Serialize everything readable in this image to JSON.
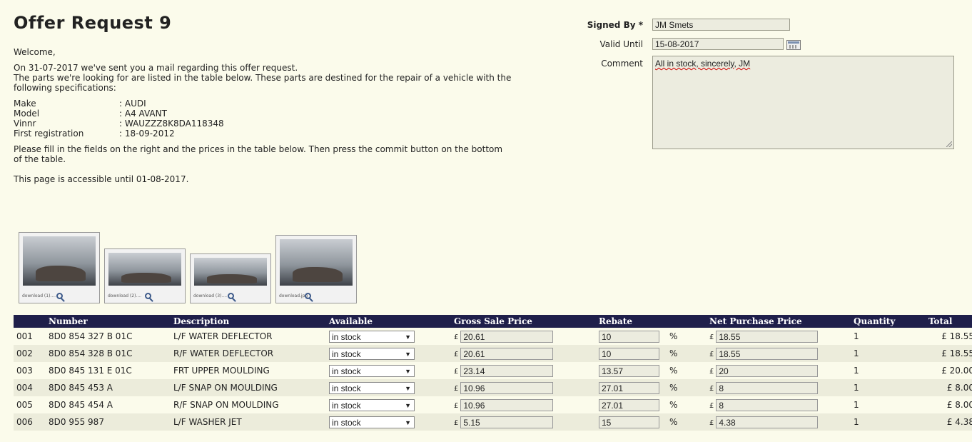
{
  "page": {
    "title": "Offer Request 9",
    "welcome": "Welcome,",
    "intro_line1": "On 31-07-2017 we've sent you a mail regarding this offer request.",
    "intro_line2": "The parts we're looking for are listed in the table below. These parts are destined for the repair of a vehicle with the following specifications:",
    "specs": [
      {
        "label": "Make",
        "value": ": AUDI"
      },
      {
        "label": "Model",
        "value": ": A4 AVANT"
      },
      {
        "label": "Vinnr",
        "value": ": WAUZZZ8K8DA118348"
      },
      {
        "label": "First registration",
        "value": ": 18-09-2012"
      }
    ],
    "instructions": "Please fill in the fields on the right and the prices in the table below. Then press the commit button on the bottom of the table.",
    "accessible": "This page is accessible until 01-08-2017."
  },
  "form": {
    "signed_by_label": "Signed By *",
    "signed_by_value": "JM Smets",
    "valid_until_label": "Valid Until",
    "valid_until_value": "15-08-2017",
    "comment_label": "Comment",
    "comment_value": "All in stock, sincerely, JM"
  },
  "thumbnails": [
    {
      "caption": "download (1)...."
    },
    {
      "caption": "download (2)...."
    },
    {
      "caption": "download (3)...."
    },
    {
      "caption": "download.jpg"
    }
  ],
  "table": {
    "headers": [
      "Number",
      "Description",
      "Available",
      "Gross Sale Price",
      "Rebate",
      "Net Purchase Price",
      "Quantity",
      "Total"
    ],
    "currency": "£",
    "percent": "%",
    "rows": [
      {
        "idx": "001",
        "number": "8D0 854 327 B 01C",
        "description": "L/F WATER DEFLECTOR",
        "available": "in stock",
        "gross": "20.61",
        "rebate": "10",
        "net": "18.55",
        "quantity": "1",
        "total": "£ 18.55"
      },
      {
        "idx": "002",
        "number": "8D0 854 328 B 01C",
        "description": "R/F WATER DEFLECTOR",
        "available": "in stock",
        "gross": "20.61",
        "rebate": "10",
        "net": "18.55",
        "quantity": "1",
        "total": "£ 18.55"
      },
      {
        "idx": "003",
        "number": "8D0 845 131 E 01C",
        "description": "FRT UPPER MOULDING",
        "available": "in stock",
        "gross": "23.14",
        "rebate": "13.57",
        "net": "20",
        "quantity": "1",
        "total": "£ 20.00"
      },
      {
        "idx": "004",
        "number": "8D0 845 453 A",
        "description": "L/F SNAP ON MOULDING",
        "available": "in stock",
        "gross": "10.96",
        "rebate": "27.01",
        "net": "8",
        "quantity": "1",
        "total": "£ 8.00"
      },
      {
        "idx": "005",
        "number": "8D0 845 454 A",
        "description": "R/F SNAP ON MOULDING",
        "available": "in stock",
        "gross": "10.96",
        "rebate": "27.01",
        "net": "8",
        "quantity": "1",
        "total": "£ 8.00"
      },
      {
        "idx": "006",
        "number": "8D0 955 987",
        "description": "L/F WASHER JET",
        "available": "in stock",
        "gross": "5.15",
        "rebate": "15",
        "net": "4.38",
        "quantity": "1",
        "total": "£ 4.38"
      }
    ]
  }
}
